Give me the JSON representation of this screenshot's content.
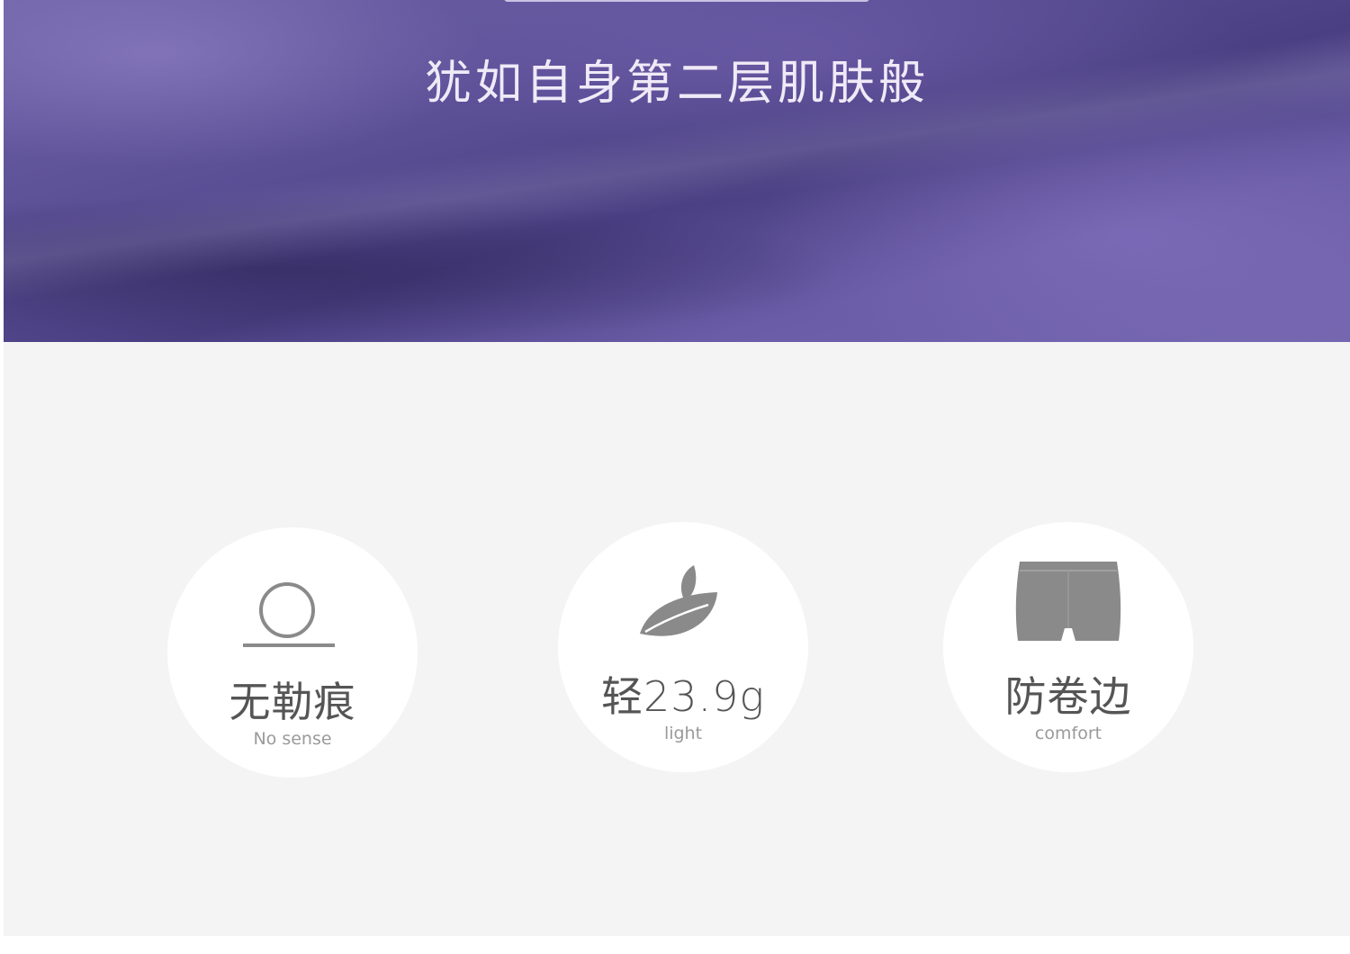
{
  "hero": {
    "title": "犹如自身第二层肌肤般"
  },
  "features": [
    {
      "title": "无勒痕",
      "subtitle": "No sense",
      "icon": "no-mark-circle-icon"
    },
    {
      "title": "轻23.9g",
      "subtitle": "light",
      "icon": "leaf-icon"
    },
    {
      "title": "防卷边",
      "subtitle": "comfort",
      "icon": "shorts-icon"
    }
  ],
  "colors": {
    "hero_purple": "#5a4e95",
    "panel_bg": "#f4f4f4",
    "icon_gray": "#8a8a8a"
  }
}
